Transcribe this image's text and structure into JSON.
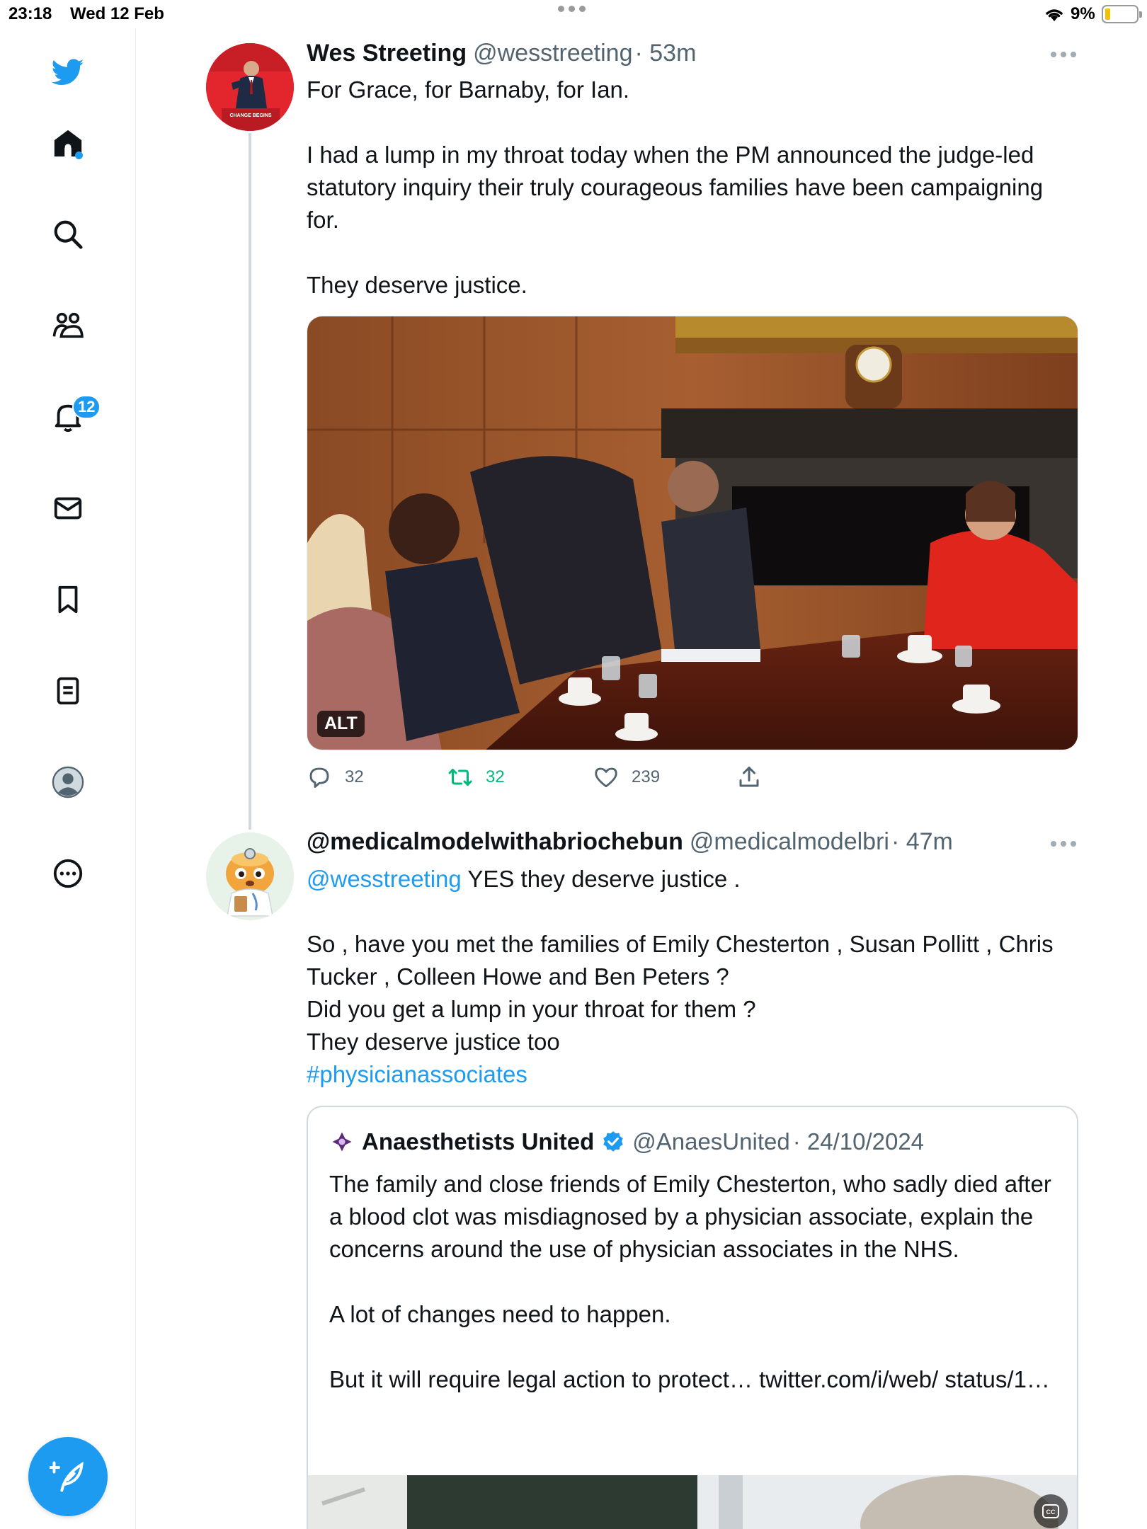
{
  "status_bar": {
    "time": "23:18",
    "date": "Wed 12 Feb",
    "battery_percent": "9%",
    "battery_level": 0.09
  },
  "sidebar": {
    "notifications_badge": "12",
    "icons": [
      "twitter-logo-icon",
      "home-icon",
      "search-icon",
      "communities-icon",
      "bell-icon",
      "mail-icon",
      "bookmark-icon",
      "lists-icon",
      "profile-icon",
      "more-circle-icon"
    ]
  },
  "tweet1": {
    "name": "Wes Streeting",
    "handle": "@wesstreeting",
    "time": "· 53m",
    "avatar_banner": "CHANGE BEGINS",
    "text": [
      "For Grace, for Barnaby, for Ian.",
      "",
      "I had a lump in my throat today when the PM announced the judge-led statutory inquiry their truly courageous families have been campaigning for.",
      "",
      "They deserve justice."
    ],
    "photo_alt_badge": "ALT",
    "replies": "32",
    "retweets": "32",
    "likes": "239"
  },
  "tweet2": {
    "name": "@medicalmodelwithabriochebun",
    "handle": "@medicalmodelbri",
    "time": "· 47m",
    "mention": "@wesstreeting",
    "first_line_rest": " YES they deserve justice .",
    "text": [
      "",
      "So , have you met the families of Emily Chesterton , Susan Pollitt , Chris Tucker , Colleen Howe and Ben Peters ?",
      "Did you get a lump in your throat for them ?",
      "They deserve justice too"
    ],
    "hashtag": "#physicianassociates"
  },
  "quote": {
    "name": "Anaesthetists United",
    "handle": "@AnaesUnited",
    "time": "· 24/10/2024",
    "text": [
      "The family and close friends of Emily Chesterton, who sadly died after a blood clot was misdiagnosed by a physician associate, explain the concerns around the use of physician associates in the NHS.",
      "",
      "A lot of changes need to happen.",
      "",
      "But it will require legal action to protect… twitter.com/i/web/ status/1…"
    ]
  },
  "colors": {
    "accent": "#1d9bf0",
    "retweet_green": "#00ba7c",
    "muted": "#536471"
  }
}
